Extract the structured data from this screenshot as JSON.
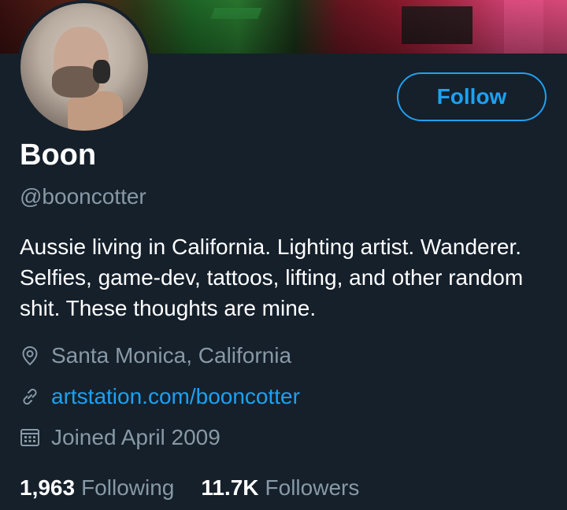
{
  "profile": {
    "name": "Boon",
    "handle": "@booncotter",
    "bio": "Aussie living in California. Lighting artist. Wanderer. Selfies, game-dev, tattoos, lifting, and other random shit. These thoughts are mine.",
    "location": "Santa Monica, California",
    "website": "artstation.com/booncotter",
    "joined": "Joined April 2009"
  },
  "actions": {
    "follow_label": "Follow"
  },
  "stats": {
    "following_count": "1,963",
    "following_label": "Following",
    "followers_count": "11.7K",
    "followers_label": "Followers"
  },
  "icons": {
    "location": "location-pin-icon",
    "link": "link-icon",
    "joined": "calendar-icon"
  },
  "colors": {
    "background": "#15202b",
    "accent": "#1da1f2",
    "secondary_text": "#8899a6"
  }
}
